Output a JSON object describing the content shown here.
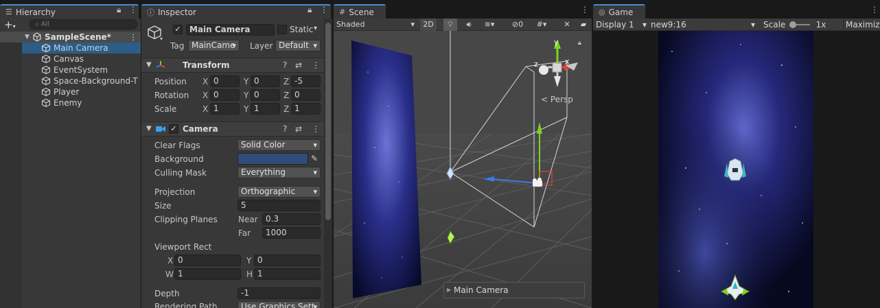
{
  "hierarchy": {
    "tab_label": "Hierarchy",
    "search_placeholder": "All",
    "scene_name": "SampleScene*",
    "items": [
      {
        "label": "Main Camera"
      },
      {
        "label": "Canvas"
      },
      {
        "label": "EventSystem"
      },
      {
        "label": "Space-Background-T"
      },
      {
        "label": "Player"
      },
      {
        "label": "Enemy"
      }
    ]
  },
  "inspector": {
    "tab_label": "Inspector",
    "object_name": "Main Camera",
    "static_label": "Static",
    "tag_label": "Tag",
    "tag_value": "MainCame",
    "layer_label": "Layer",
    "layer_value": "Default",
    "transform": {
      "title": "Transform",
      "position_label": "Position",
      "rotation_label": "Rotation",
      "scale_label": "Scale",
      "position": {
        "x": "0",
        "y": "0",
        "z": "-5"
      },
      "rotation": {
        "x": "0",
        "y": "0",
        "z": "0"
      },
      "scale": {
        "x": "1",
        "y": "1",
        "z": "1"
      }
    },
    "camera": {
      "title": "Camera",
      "clear_flags_label": "Clear Flags",
      "clear_flags_value": "Solid Color",
      "background_label": "Background",
      "background_color": "#314d79",
      "culling_mask_label": "Culling Mask",
      "culling_mask_value": "Everything",
      "projection_label": "Projection",
      "projection_value": "Orthographic",
      "size_label": "Size",
      "size_value": "5",
      "clipping_label": "Clipping Planes",
      "near_label": "Near",
      "near_value": "0.3",
      "far_label": "Far",
      "far_value": "1000",
      "viewport_label": "Viewport Rect",
      "vp": {
        "x": "0",
        "y": "0",
        "w": "1",
        "h": "1"
      },
      "depth_label": "Depth",
      "depth_value": "-1",
      "rendering_path_label": "Rendering Path",
      "rendering_path_value": "Use Graphics Sett"
    },
    "axis": {
      "x": "X",
      "y": "Y",
      "z": "Z",
      "w": "W",
      "h": "H"
    }
  },
  "scene": {
    "tab_label": "Scene",
    "shading_mode": "Shaded",
    "btn_2d": "2D",
    "hidden_count": "0",
    "persp_label": "Persp",
    "camera_overlay_label": "Main Camera",
    "gizmo_axes": {
      "x": "x",
      "y": "y",
      "z": "z"
    }
  },
  "game": {
    "tab_label": "Game",
    "display": "Display 1",
    "aspect": "new9:16",
    "scale_label": "Scale",
    "scale_value": "1x",
    "maximize": "Maximize"
  }
}
